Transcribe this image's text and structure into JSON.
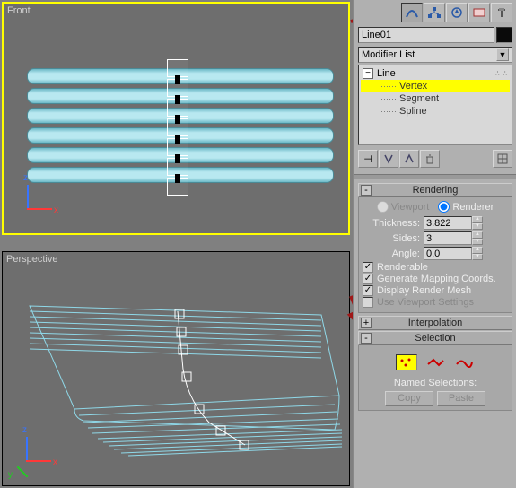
{
  "viewports": {
    "front_label": "Front",
    "perspective_label": "Perspective",
    "axes": {
      "x": "x",
      "y": "y",
      "z": "z"
    }
  },
  "object": {
    "name": "Line01"
  },
  "modifier_dropdown": "Modifier List",
  "stack": {
    "root": "Line",
    "subs": [
      "Vertex",
      "Segment",
      "Spline"
    ],
    "selected": "Vertex"
  },
  "rendering": {
    "title": "Rendering",
    "viewport_label": "Viewport",
    "renderer_label": "Renderer",
    "thickness_label": "Thickness:",
    "thickness_value": "3.822",
    "sides_label": "Sides:",
    "sides_value": "3",
    "angle_label": "Angle:",
    "angle_value": "0.0",
    "renderable": "Renderable",
    "gen_mapping": "Generate Mapping Coords.",
    "display_mesh": "Display Render Mesh",
    "use_vp": "Use Viewport Settings"
  },
  "interpolation": {
    "title": "Interpolation"
  },
  "selection": {
    "title": "Selection",
    "named_label": "Named Selections:",
    "copy": "Copy",
    "paste": "Paste"
  }
}
